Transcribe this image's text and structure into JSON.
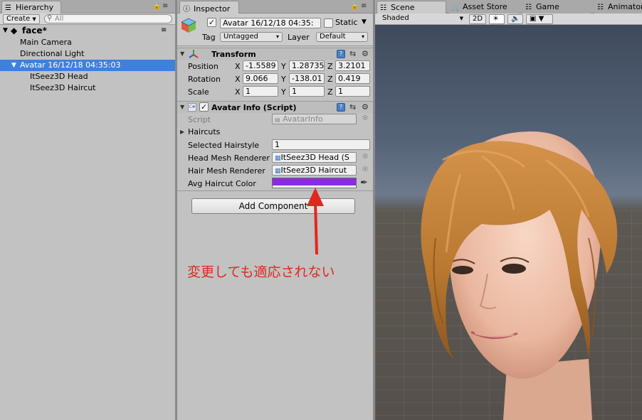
{
  "hierarchy": {
    "tab_label": "Hierarchy",
    "create_label": "Create",
    "search_placeholder": "All",
    "scene_name": "face*",
    "items": [
      {
        "label": "Main Camera"
      },
      {
        "label": "Directional Light"
      },
      {
        "label": "Avatar 16/12/18 04:35:03"
      },
      {
        "label": "ItSeez3D Head"
      },
      {
        "label": "ItSeez3D Haircut"
      }
    ]
  },
  "inspector": {
    "tab_label": "Inspector",
    "object_name": "Avatar 16/12/18 04:35:",
    "static_label": "Static",
    "tag_label": "Tag",
    "tag_value": "Untagged",
    "layer_label": "Layer",
    "layer_value": "Default",
    "transform": {
      "title": "Transform",
      "rows": [
        {
          "label": "Position",
          "x": "-1.5589",
          "y": "1.28735",
          "z": "3.2101"
        },
        {
          "label": "Rotation",
          "x": "9.066",
          "y": "-138.01",
          "z": "0.419"
        },
        {
          "label": "Scale",
          "x": "1",
          "y": "1",
          "z": "1"
        }
      ],
      "axis_x": "X",
      "axis_y": "Y",
      "axis_z": "Z"
    },
    "avatar_info": {
      "title": "Avatar Info (Script)",
      "script_label": "Script",
      "script_value": "AvatarInfo",
      "haircuts_label": "Haircuts",
      "selected_hairstyle_label": "Selected Hairstyle",
      "selected_hairstyle_value": "1",
      "head_mesh_label": "Head Mesh Renderer",
      "head_mesh_value": "ItSeez3D Head (S",
      "hair_mesh_label": "Hair Mesh Renderer",
      "hair_mesh_value": "ItSeez3D Haircut",
      "color_label": "Avg Haircut Color",
      "color_value": "#8a2be2"
    },
    "add_component_label": "Add Component"
  },
  "scene": {
    "tabs": [
      {
        "label": "Scene"
      },
      {
        "label": "Asset Store"
      },
      {
        "label": "Game"
      },
      {
        "label": "Animator"
      }
    ],
    "shading_mode": "Shaded",
    "mode_2d": "2D",
    "hair_color": "#b9782f",
    "skin_color": "#f3c9b4"
  },
  "annotation": {
    "text": "変更しても適応されない",
    "color": "#e0281e"
  }
}
